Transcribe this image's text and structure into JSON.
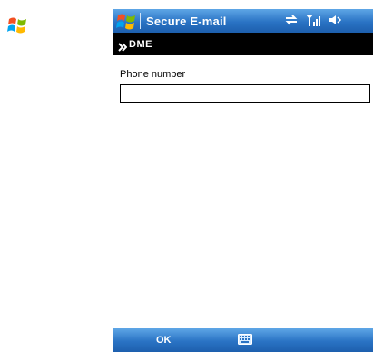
{
  "title_bar": {
    "app_title": "Secure E-mail",
    "status_icons": [
      "connectivity-icon",
      "signal-strength-icon",
      "speaker-icon"
    ]
  },
  "brand": {
    "name": "DME"
  },
  "form": {
    "phone_label": "Phone number",
    "phone_value": "",
    "phone_placeholder": ""
  },
  "softkeys": {
    "left_label": "OK",
    "center_icon": "keyboard-icon"
  },
  "colors": {
    "title_bar_blue": "#2a73c4",
    "brand_bar": "#000000"
  }
}
